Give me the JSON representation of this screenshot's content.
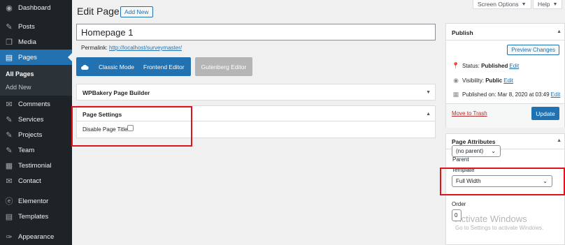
{
  "sidebar": {
    "items": [
      {
        "label": "Dashboard",
        "icon": "dashboard-icon",
        "glyph": "◉"
      },
      {
        "label": "Posts",
        "icon": "pin-icon",
        "glyph": "✎"
      },
      {
        "label": "Media",
        "icon": "media-icon",
        "glyph": "❒"
      },
      {
        "label": "Pages",
        "icon": "pages-icon",
        "glyph": "▤"
      },
      {
        "label": "Comments",
        "icon": "comments-icon",
        "glyph": "✉"
      },
      {
        "label": "Services",
        "icon": "services-icon",
        "glyph": "✎"
      },
      {
        "label": "Projects",
        "icon": "projects-icon",
        "glyph": "✎"
      },
      {
        "label": "Team",
        "icon": "team-icon",
        "glyph": "✎"
      },
      {
        "label": "Testimonial",
        "icon": "testimonial-icon",
        "glyph": "▦"
      },
      {
        "label": "Contact",
        "icon": "contact-icon",
        "glyph": "✉"
      },
      {
        "label": "Elementor",
        "icon": "elementor-icon",
        "glyph": "ⓔ"
      },
      {
        "label": "Templates",
        "icon": "templates-icon",
        "glyph": "▤"
      },
      {
        "label": "Appearance",
        "icon": "appearance-icon",
        "glyph": "✑"
      }
    ],
    "submenu": [
      "All Pages",
      "Add New"
    ]
  },
  "header": {
    "title": "Edit Page",
    "add_new": "Add New",
    "screen_options": "Screen Options",
    "help": "Help"
  },
  "editor": {
    "title_value": "Homepage 1",
    "permalink_label": "Permalink:",
    "permalink_url": "http://localhost/surveymaster/",
    "classic_mode": "Classic Mode",
    "frontend_editor": "Frontend Editor",
    "gutenberg_editor": "Gutenberg Editor"
  },
  "wpbakery": {
    "title": "WPBakery Page Builder"
  },
  "page_settings": {
    "title": "Page Settings",
    "disable_title_label": "Disable Page Title"
  },
  "publish": {
    "title": "Publish",
    "preview": "Preview Changes",
    "status_label": "Status:",
    "status_value": "Published",
    "visibility_label": "Visibility:",
    "visibility_value": "Public",
    "published_label": "Published on:",
    "published_value": "Mar 8, 2020 at 03:49",
    "edit": "Edit",
    "move_to_trash": "Move to Trash",
    "update": "Update"
  },
  "attributes": {
    "title": "Page Attributes",
    "parent_label": "Parent",
    "parent_value": "(no parent)",
    "template_label": "Template",
    "template_value": "Full Width",
    "order_label": "Order",
    "order_value": "0"
  },
  "watermark": {
    "line1": "Activate Windows",
    "line2": "Go to Settings to activate Windows."
  },
  "colors": {
    "accent": "#2271b1",
    "highlight": "#e0121b",
    "sidebar": "#1d2327"
  }
}
